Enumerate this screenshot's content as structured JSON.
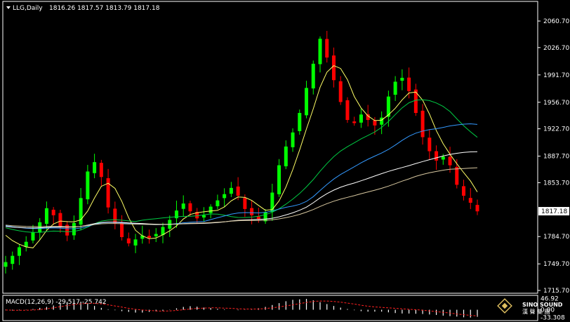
{
  "header": {
    "symbol": "LLG,Daily",
    "ohlc": "1816.26 1817.57 1813.79 1817.18"
  },
  "price_panel": {
    "y_ticks": [
      2060.7,
      2026.7,
      1991.7,
      1956.7,
      1922.7,
      1887.7,
      1853.7,
      1817.18,
      1784.7,
      1749.7,
      1715.7
    ],
    "y_tick_labels": [
      "2060.70",
      "2026.70",
      "1991.70",
      "1956.70",
      "1922.70",
      "1887.70",
      "1853.70",
      "1817.18",
      "1784.70",
      "1749.70",
      "1715.70"
    ],
    "current_price_label": "1817.18"
  },
  "macd_panel": {
    "label": "MACD(12,26,9) -29.517 -25.742",
    "y_ticks": [
      46.92,
      0.0,
      -33.308
    ],
    "y_tick_labels": [
      "46.92",
      "0.00",
      "-33.308"
    ]
  },
  "watermark": {
    "brand": "SINO SOUND",
    "sub": "漢 聲 集 團"
  },
  "colors": {
    "background": "#000000",
    "bull_candle": "#00ff00",
    "bear_candle": "#ff0000",
    "ma_short": "#ffff66",
    "ma_mid": "#00cc44",
    "ma_long": "#3399ff",
    "ma_slow": "#ffffff",
    "ma_slowest": "#d8c8a0",
    "macd_hist": "#ffffff",
    "macd_signal": "#ff2020"
  },
  "chart_data": {
    "type": "candlestick",
    "timeframe": "Daily",
    "approx_closes": [
      1752,
      1760,
      1771,
      1778,
      1790,
      1803,
      1821,
      1812,
      1797,
      1786,
      1802,
      1834,
      1868,
      1880,
      1861,
      1822,
      1801,
      1784,
      1776,
      1781,
      1786,
      1783,
      1788,
      1797,
      1806,
      1818,
      1827,
      1817,
      1808,
      1812,
      1823,
      1831,
      1839,
      1847,
      1837,
      1820,
      1812,
      1807,
      1816,
      1841,
      1876,
      1900,
      1918,
      1943,
      1975,
      2006,
      2038,
      2014,
      1985,
      1957,
      1934,
      1930,
      1941,
      1934,
      1927,
      1937,
      1964,
      1983,
      1988,
      1971,
      1943,
      1912,
      1894,
      1882,
      1887,
      1876,
      1851,
      1837,
      1828,
      1817
    ],
    "macd_hist": [
      -2,
      -3,
      -2,
      -1,
      3,
      8,
      12,
      18,
      26,
      33,
      37,
      34,
      26,
      16,
      8,
      2,
      -2,
      -6,
      -9,
      -12,
      -12,
      -9,
      -7,
      -4,
      1,
      6,
      12,
      15,
      13,
      9,
      7,
      4,
      2,
      0,
      -2,
      -1,
      1,
      6,
      12,
      20,
      28,
      36,
      42,
      44,
      46,
      40,
      32,
      24,
      16,
      9,
      3,
      -2,
      -6,
      -8,
      -8,
      -8,
      -11,
      -14,
      -16,
      -16,
      -17,
      -18,
      -20,
      -22,
      -25,
      -27,
      -29,
      -32,
      -33,
      -30
    ],
    "macd_signal": [
      -1,
      -2,
      -2,
      -2,
      -1,
      1,
      4,
      8,
      13,
      18,
      22,
      25,
      27,
      27,
      25,
      21,
      16,
      11,
      6,
      2,
      -1,
      -3,
      -5,
      -6,
      -5,
      -3,
      0,
      3,
      6,
      7,
      8,
      8,
      7,
      6,
      4,
      3,
      3,
      3,
      5,
      8,
      12,
      16,
      21,
      26,
      31,
      35,
      37,
      37,
      35,
      32,
      28,
      24,
      19,
      15,
      12,
      10,
      8,
      6,
      4,
      2,
      0,
      -2,
      -5,
      -8,
      -11,
      -14,
      -18,
      -21,
      -24,
      -26
    ],
    "series": [
      {
        "key": "ma_short"
      },
      {
        "key": "ma_mid"
      },
      {
        "key": "ma_long"
      },
      {
        "key": "ma_slow"
      },
      {
        "key": "ma_slowest"
      }
    ],
    "ylim": [
      1715.7,
      2070
    ],
    "macd_ylim": [
      -40,
      55
    ],
    "grid": false,
    "legend": "none"
  }
}
